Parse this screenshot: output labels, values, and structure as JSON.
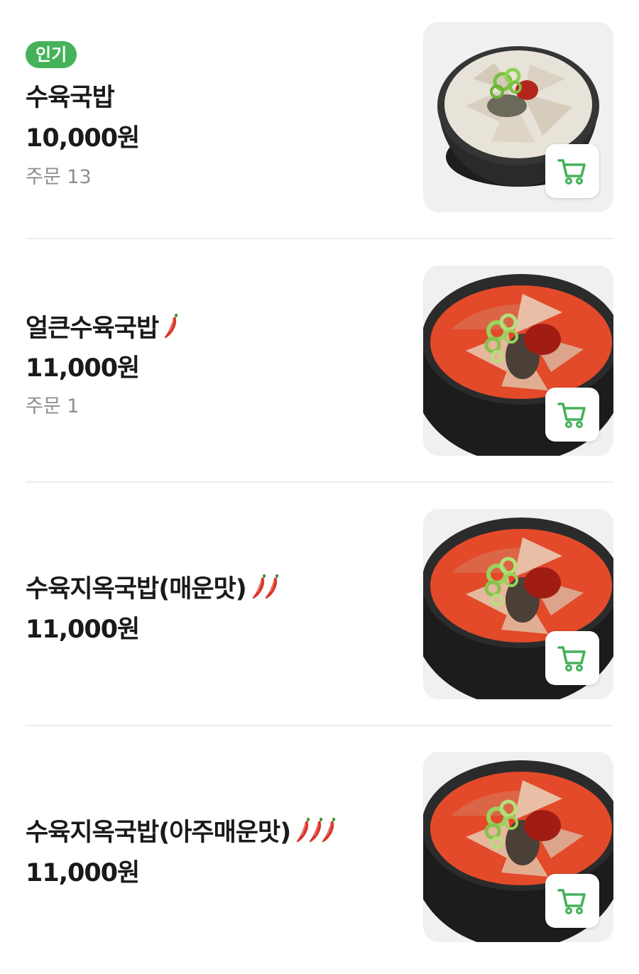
{
  "accent_color": "#45b25a",
  "menu": [
    {
      "badge": "인기",
      "name": "수육국밥",
      "spice_level": 0,
      "price": "10,000원",
      "orders": "주문 13",
      "image": "white-broth-gukbap-photo",
      "cart_icon": "cart-icon"
    },
    {
      "name": "얼큰수육국밥",
      "spice_level": 1,
      "price": "11,000원",
      "orders": "주문 1",
      "image": "red-broth-gukbap-photo",
      "cart_icon": "cart-icon"
    },
    {
      "name": "수육지옥국밥(매운맛)",
      "spice_level": 2,
      "price": "11,000원",
      "image": "red-broth-gukbap-photo",
      "cart_icon": "cart-icon"
    },
    {
      "name": "수육지옥국밥(아주매운맛)",
      "spice_level": 3,
      "price": "11,000원",
      "image": "red-broth-gukbap-photo",
      "cart_icon": "cart-icon"
    }
  ]
}
